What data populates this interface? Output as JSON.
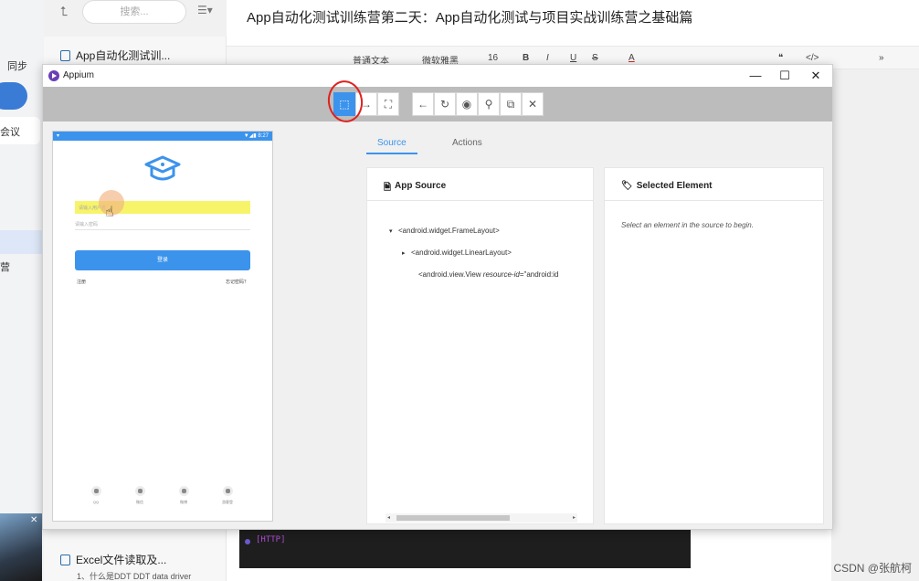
{
  "note_app": {
    "sidebar": {
      "sync_label": "同步",
      "meeting_label": "会议",
      "camp_label": "营"
    },
    "note_list": {
      "search_placeholder": "搜索...",
      "items": [
        {
          "title": "App自动化测试训..."
        },
        {
          "title": "Excel文件读取及...",
          "preview": "1、什么是DDT DDT data driver"
        }
      ]
    },
    "editor": {
      "title": "App自动化测试训练营第二天：App自动化测试与项目实战训练营之基础篇",
      "toolbar": {
        "text_style": "普通文本",
        "font": "微软雅黑",
        "size": "16",
        "bold": "B",
        "italic": "I",
        "underline": "U",
        "strike": "S",
        "font_color": "A",
        "quote": "❝",
        "code": "</>",
        "more": "»"
      }
    },
    "console_tag": "[HTTP]"
  },
  "appium": {
    "window_title": "Appium",
    "window_buttons": {
      "minimize": "—",
      "maximize": "☐",
      "close": "✕"
    },
    "phone": {
      "status_left": "▾",
      "status_right": "▼◢▮ 8:27",
      "username_placeholder": "请输入用户名",
      "password_placeholder": "请输入密码",
      "login_button": "登录",
      "register_link": "注册",
      "forgot_link": "忘记密码？",
      "bottom_nav": [
        "QQ",
        "微信",
        "微博",
        "游客登"
      ]
    },
    "tabs": {
      "source": "Source",
      "actions": "Actions"
    },
    "source_panel": {
      "title": "App Source",
      "nodes": [
        {
          "caret": "▾",
          "text": "<android.widget.FrameLayout>"
        },
        {
          "caret": "▸",
          "text": "<android.widget.LinearLayout>"
        },
        {
          "caret": "",
          "text_prefix": "<android.view.View ",
          "attr_name": "resource-id",
          "attr_value": "=\"android:id"
        }
      ]
    },
    "element_panel": {
      "title": "Selected Element",
      "message": "Select an element in the source to begin."
    }
  },
  "watermark": "CSDN @张航柯"
}
